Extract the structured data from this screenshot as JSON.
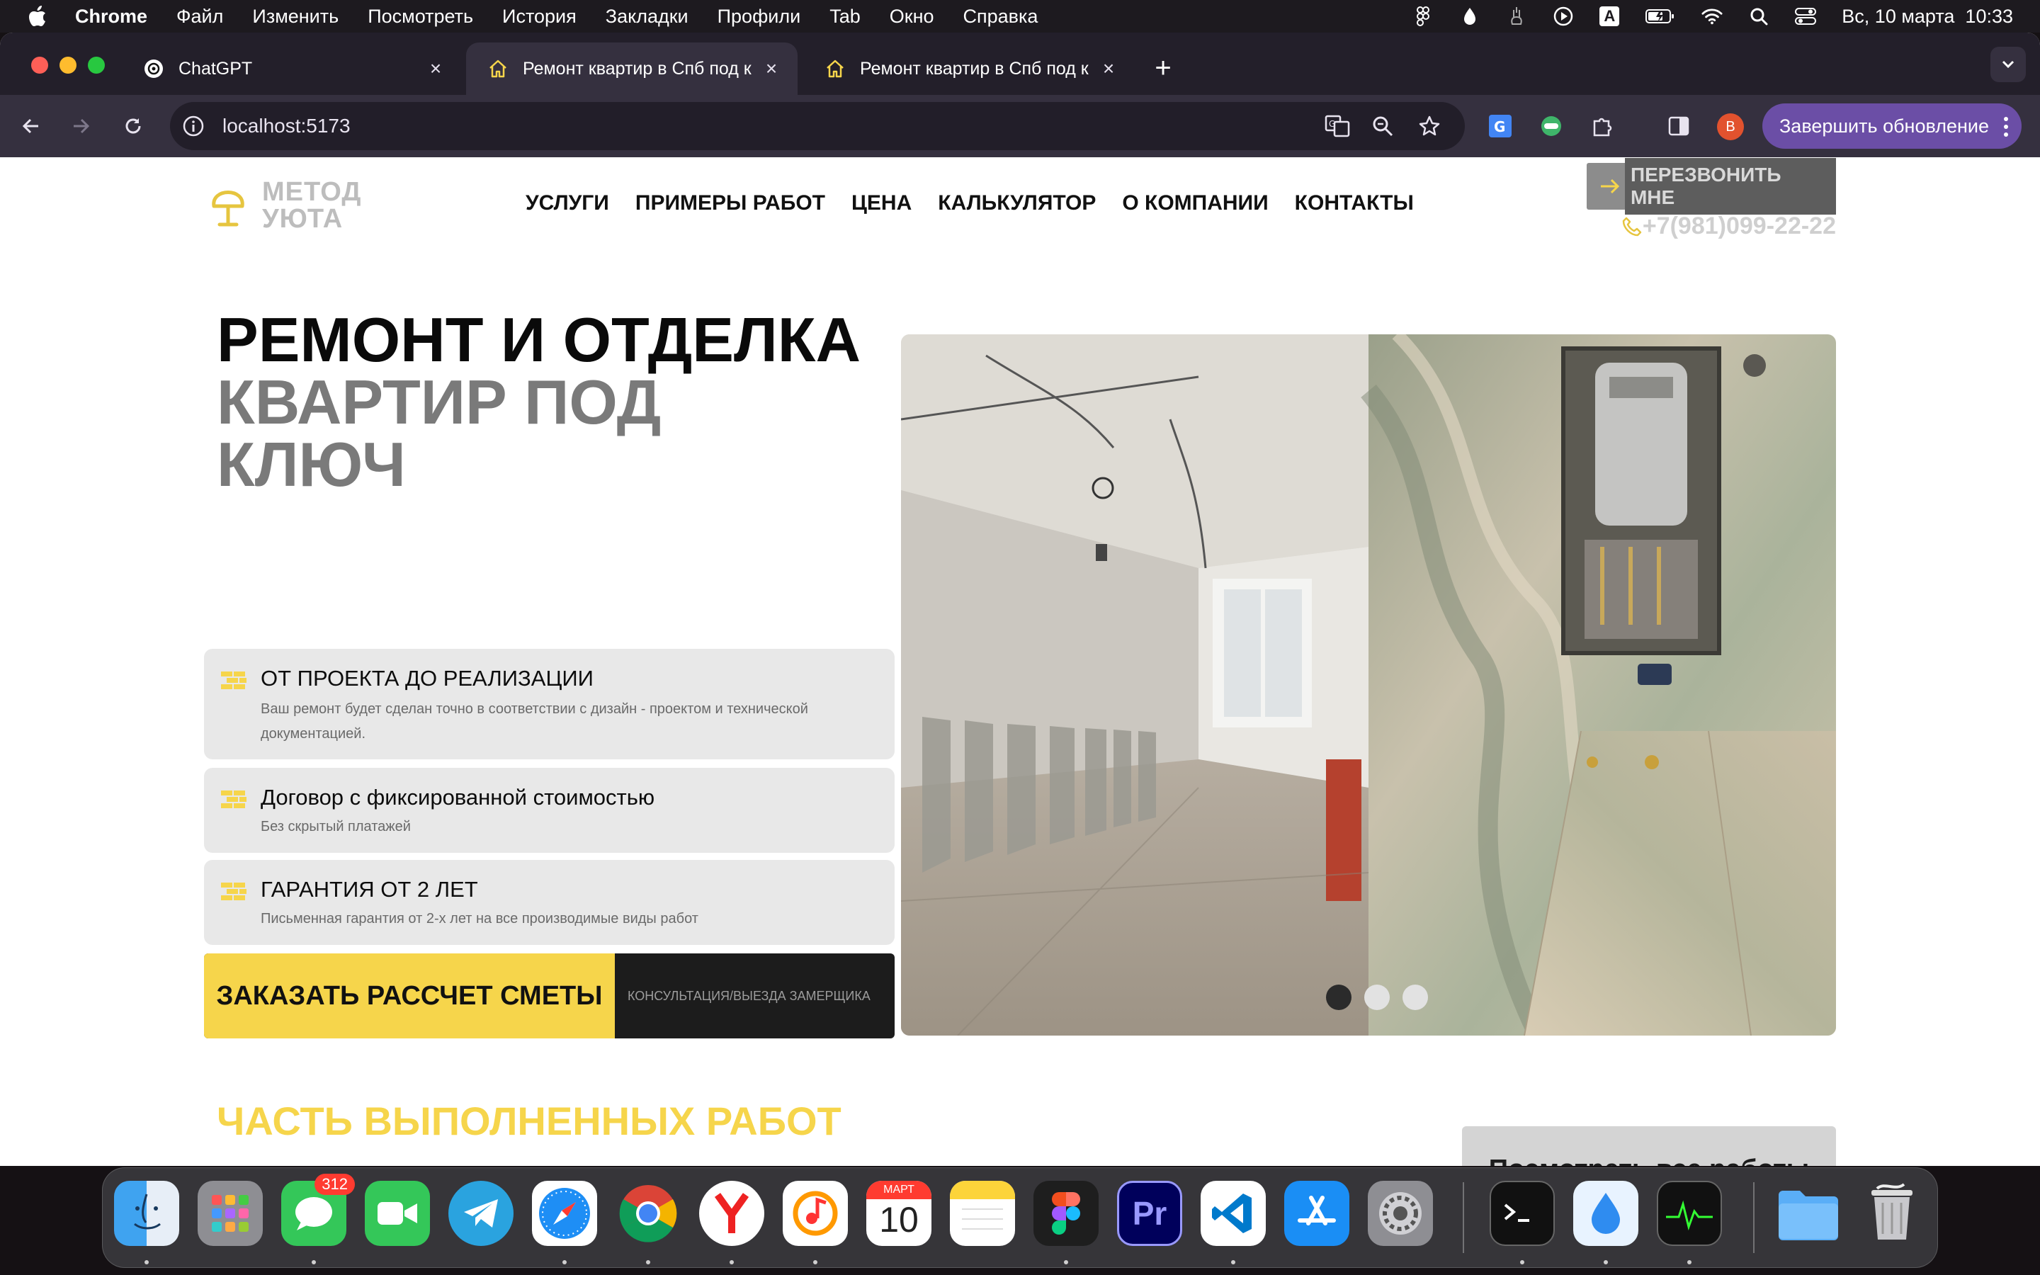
{
  "menubar": {
    "app": "Chrome",
    "items": [
      "Файл",
      "Изменить",
      "Посмотреть",
      "История",
      "Закладки",
      "Профили",
      "Tab",
      "Окно",
      "Справка"
    ],
    "datetime": "Вс, 10 марта  10:33",
    "input_source": "A"
  },
  "tabs": [
    {
      "title": "ChatGPT",
      "icon": "chatgpt-icon"
    },
    {
      "title": "Ремонт квартир в Спб под к",
      "icon": "home-icon"
    },
    {
      "title": "Ремонт квартир в Спб под к",
      "icon": "home-icon"
    }
  ],
  "toolbar": {
    "url": "localhost:5173",
    "update_label": "Завершить обновление",
    "profile_initial": "B"
  },
  "site": {
    "logo_line1": "МЕТОД",
    "logo_line2": "УЮТА",
    "nav": [
      "УСЛУГИ",
      "ПРИМЕРЫ РАБОТ",
      "ЦЕНА",
      "КАЛЬКУЛЯТОР",
      "О КОМПАНИИ",
      "КОНТАКТЫ"
    ],
    "callback_label": "ПЕРЕЗВОНИТЬ МНЕ",
    "phone": "+7(981)099-22-22",
    "hero_line1": "РЕМОНТ И ОТДЕЛКА",
    "hero_line2": "КВАРТИР ПОД",
    "hero_line3": "КЛЮЧ",
    "features": [
      {
        "title": "ОТ ПРОЕКТА ДО РЕАЛИЗАЦИИ",
        "desc": "Ваш ремонт будет сделан точно в соответствии с дизайн - проектом и технической документацией."
      },
      {
        "title": "Договор с фиксированной стоимостью",
        "desc": "Без скрытый платажей"
      },
      {
        "title": "ГАРАНТИЯ ОТ 2 ЛЕТ",
        "desc": "Письменная гарантия от 2-х лет на все производимые виды работ"
      }
    ],
    "cta_label": "ЗАКАЗАТЬ РАССЧЕТ СМЕТЫ",
    "cta_sub": "КОНСУЛЬТАЦИЯ/ВЫЕЗДА ЗАМЕРЩИКА",
    "slider_dots": 3,
    "slider_active_index": 0,
    "works_title": "ЧАСТЬ ВЫПОЛНЕННЫХ РАБОТ",
    "works_button": "Посмотреть все работы"
  },
  "dock": {
    "messages_badge": "312",
    "calendar_month": "МАРТ",
    "calendar_day": "10",
    "apps": [
      "finder",
      "launchpad",
      "messages",
      "facetime",
      "telegram",
      "safari",
      "chrome",
      "yandex-browser",
      "music",
      "calendar",
      "notes",
      "figma",
      "premiere",
      "vscode",
      "app-store",
      "system-settings",
      "terminal",
      "drop",
      "activity-monitor",
      "folder",
      "trash"
    ]
  },
  "colors": {
    "accent_yellow": "#f6d54b",
    "chrome_tabstrip": "#231f2a",
    "chrome_toolbar": "#35303f"
  }
}
